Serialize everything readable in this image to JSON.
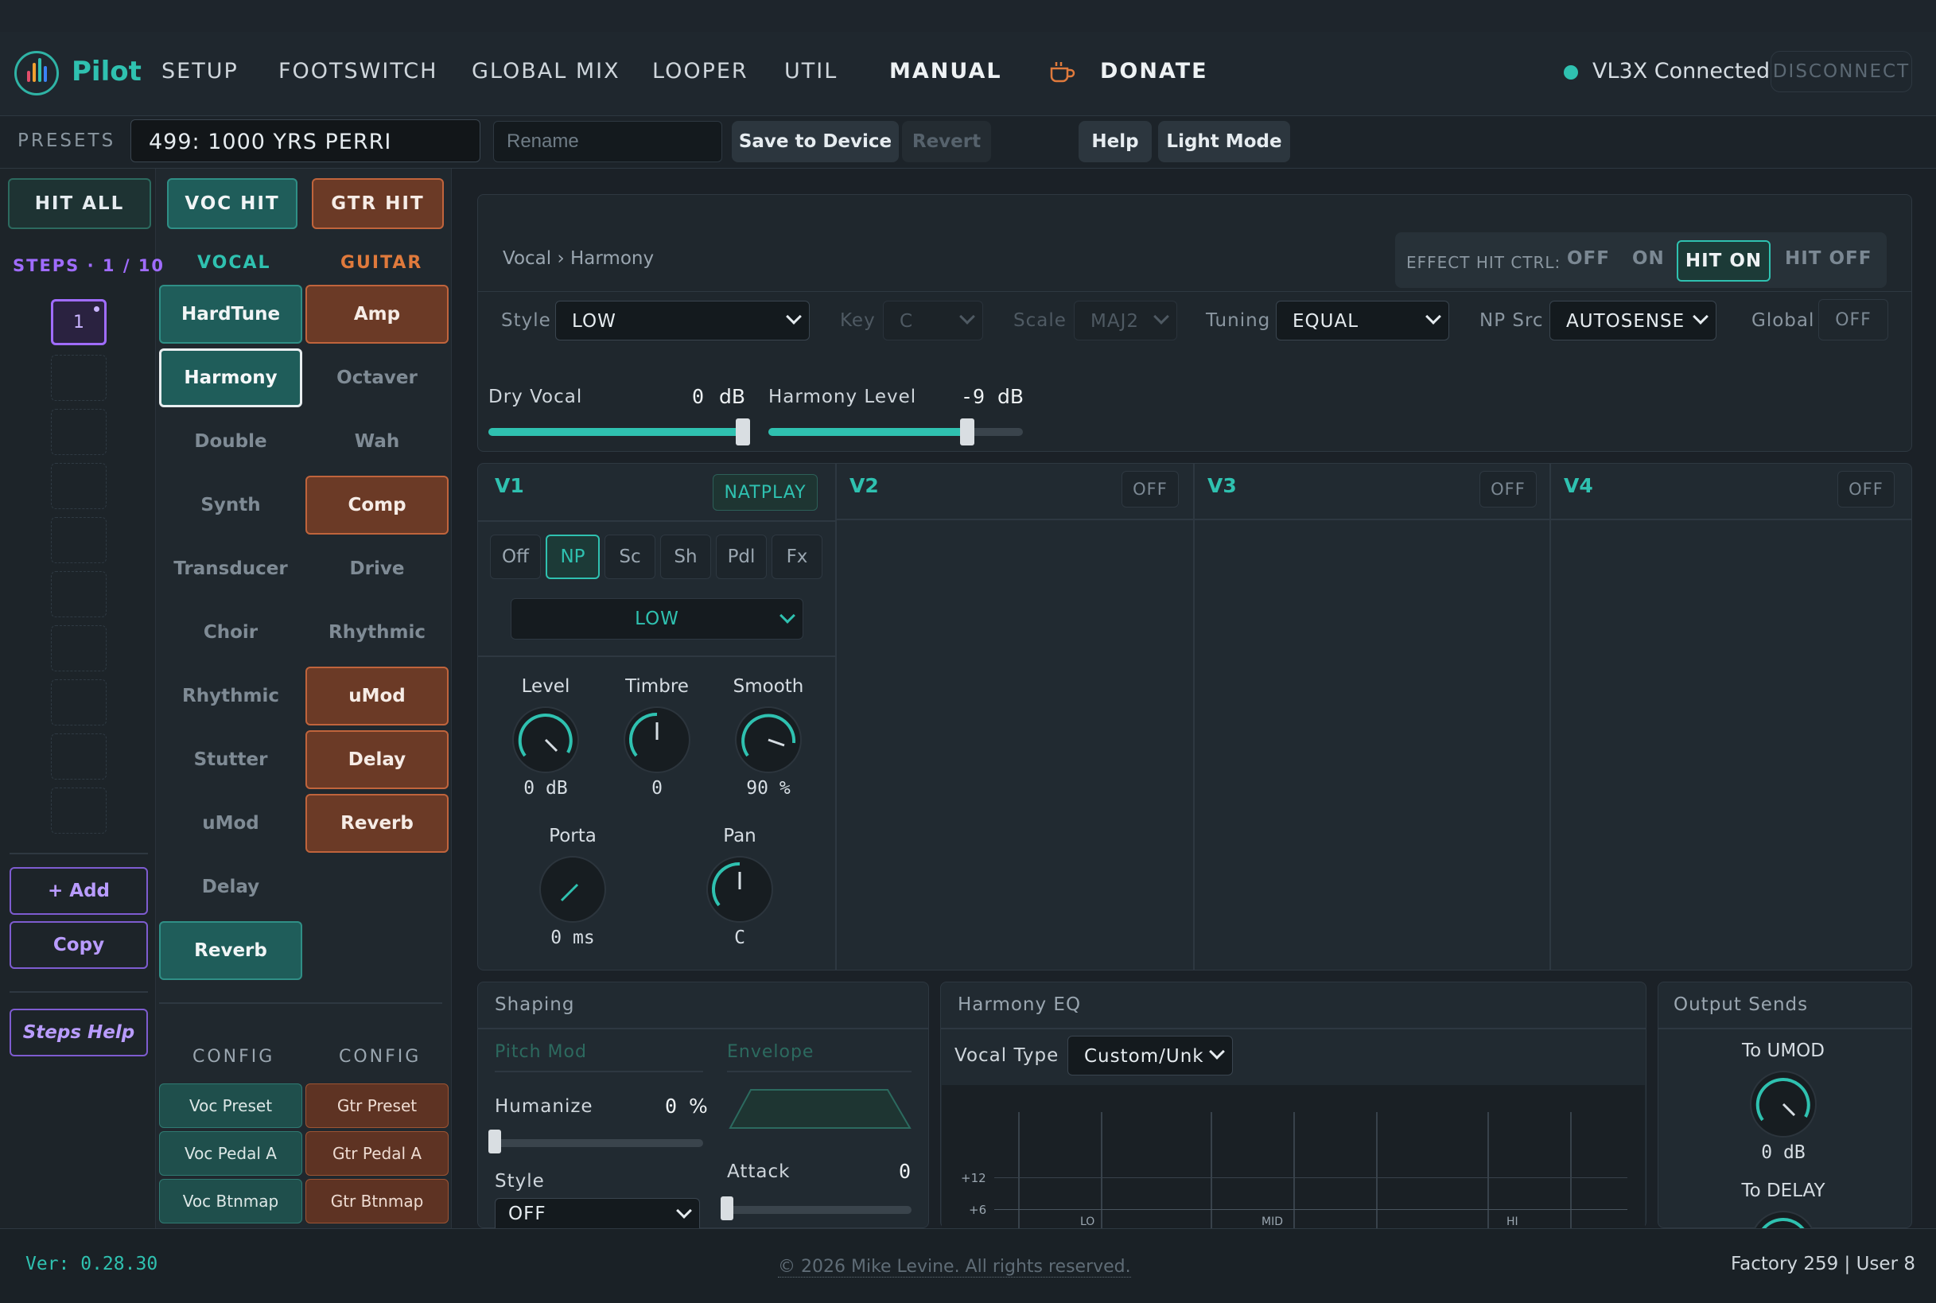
{
  "brand": "Pilot",
  "nav": [
    "SETUP",
    "FOOTSWITCH",
    "GLOBAL MIX",
    "LOOPER",
    "UTIL",
    "MANUAL",
    "DONATE"
  ],
  "status": {
    "text": "VL3X Connected",
    "disconnect": "DISCONNECT"
  },
  "preset_bar": {
    "label": "PRESETS",
    "name": "499: 1000 YRS PERRI",
    "rename_placeholder": "Rename",
    "save": "Save to Device",
    "revert": "Revert",
    "help": "Help",
    "light_mode": "Light Mode"
  },
  "hit": {
    "all": "HIT ALL",
    "voc": "VOC HIT",
    "gtr": "GTR HIT"
  },
  "steps": {
    "label": "STEPS · 1 / 10",
    "current": "1",
    "add": "+ Add",
    "copy": "Copy",
    "help": "Steps Help"
  },
  "vocal": {
    "heading": "VOCAL",
    "effects": [
      "HardTune",
      "Harmony",
      "Double",
      "Synth",
      "Transducer",
      "Choir",
      "Rhythmic",
      "Stutter",
      "uMod",
      "Delay",
      "Reverb"
    ],
    "config_heading": "CONFIG",
    "config": [
      "Voc Preset",
      "Voc Pedal A",
      "Voc Btnmap"
    ]
  },
  "guitar": {
    "heading": "GUITAR",
    "effects": [
      "Amp",
      "Octaver",
      "Wah",
      "Comp",
      "Drive",
      "Rhythmic",
      "uMod",
      "Delay",
      "Reverb"
    ],
    "config_heading": "CONFIG",
    "config": [
      "Gtr Preset",
      "Gtr Pedal A",
      "Gtr Btnmap"
    ]
  },
  "main": {
    "breadcrumb": "Vocal › Harmony",
    "hit_ctrl": {
      "label": "EFFECT HIT CTRL:",
      "options": [
        "OFF",
        "ON",
        "HIT ON",
        "HIT OFF"
      ],
      "selected": "HIT ON"
    },
    "style": {
      "label": "Style",
      "value": "LOW"
    },
    "key": {
      "label": "Key",
      "value": "C"
    },
    "scale": {
      "label": "Scale",
      "value": "MAJ2"
    },
    "tuning": {
      "label": "Tuning",
      "value": "EQUAL"
    },
    "np_src": {
      "label": "NP Src",
      "value": "AUTOSENSE"
    },
    "global": {
      "label": "Global",
      "value": "OFF"
    },
    "dry_vocal": {
      "label": "Dry Vocal",
      "value": "0",
      "unit": "dB",
      "fraction": 1.0
    },
    "harmony_level": {
      "label": "Harmony Level",
      "value": "-9",
      "unit": "dB",
      "fraction": 0.78
    }
  },
  "voices": {
    "v1": {
      "label": "V1",
      "mode": "NATPLAY",
      "tabs": [
        "Off",
        "NP",
        "Sc",
        "Sh",
        "Pdl",
        "Fx"
      ],
      "selected_tab": "NP",
      "voice": "LOW",
      "knobs": [
        {
          "label": "Level",
          "value": "0 dB"
        },
        {
          "label": "Timbre",
          "value": "0"
        },
        {
          "label": "Smooth",
          "value": "90 %"
        },
        {
          "label": "Porta",
          "value": "0 ms"
        },
        {
          "label": "Pan",
          "value": "C"
        }
      ]
    },
    "v2": {
      "label": "V2",
      "state": "OFF"
    },
    "v3": {
      "label": "V3",
      "state": "OFF"
    },
    "v4": {
      "label": "V4",
      "state": "OFF"
    }
  },
  "shaping": {
    "title": "Shaping",
    "pitch_mod": "Pitch Mod",
    "envelope": "Envelope",
    "humanize": {
      "label": "Humanize",
      "value": "0",
      "unit": "%"
    },
    "style": {
      "label": "Style",
      "value": "OFF"
    },
    "attack": {
      "label": "Attack",
      "value": "0"
    }
  },
  "harmony_eq": {
    "title": "Harmony EQ",
    "vocal_type": {
      "label": "Vocal Type",
      "value": "Custom/Unk"
    },
    "y_ticks": [
      "+12",
      "+6"
    ],
    "bands": [
      "LO",
      "MID",
      "HI"
    ]
  },
  "output_sends": {
    "title": "Output Sends",
    "umod": {
      "label": "To UMOD",
      "value": "0 dB"
    },
    "delay": {
      "label": "To DELAY"
    }
  },
  "footer": {
    "version": "Ver: 0.28.30",
    "copyright": "© 2026 Mike Levine. All rights reserved.",
    "info": "Factory 259 | User 8"
  },
  "colors": {
    "accent": "#2fc1b0",
    "vocal": "#1f5d5a",
    "guitar": "#6b3a26",
    "steps": "#a06cff"
  }
}
